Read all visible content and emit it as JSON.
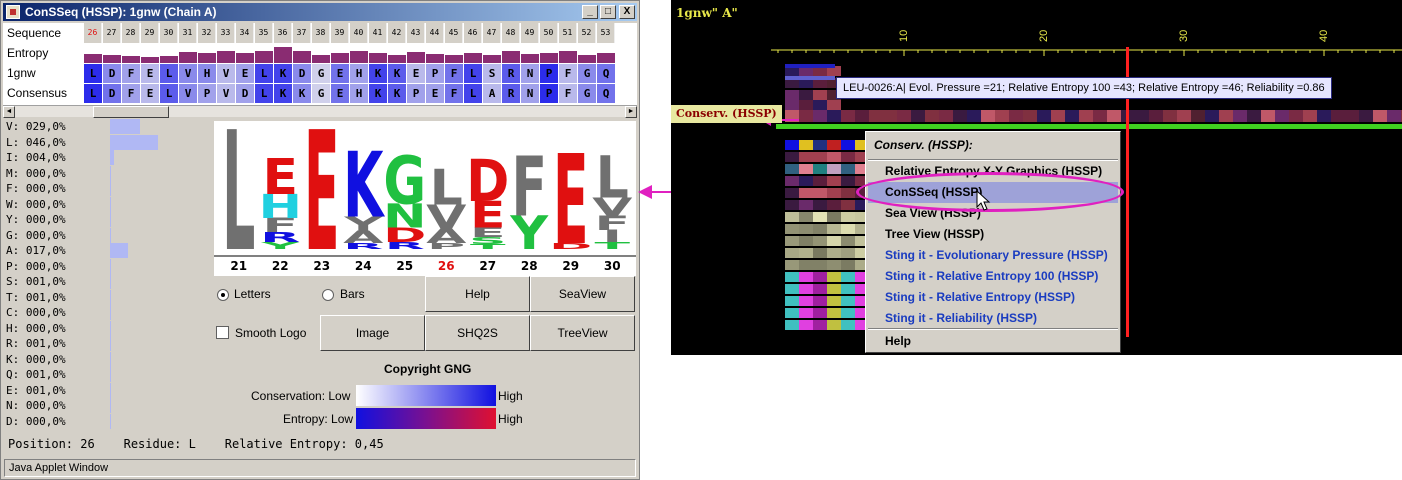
{
  "window": {
    "title": "ConSSeq (HSSP): 1gnw (Chain A)",
    "buttons": [
      "_",
      "□",
      "X"
    ]
  },
  "alignment": {
    "row_labels": [
      "Sequence",
      "Entropy",
      "1gnw",
      "Consensus"
    ],
    "numbers": [
      "26",
      "27",
      "28",
      "29",
      "30",
      "31",
      "32",
      "33",
      "34",
      "35",
      "36",
      "37",
      "38",
      "39",
      "40",
      "41",
      "42",
      "43",
      "44",
      "45",
      "46",
      "47",
      "48",
      "49",
      "50",
      "51",
      "52",
      "53"
    ],
    "current_number": "26",
    "entropy": [
      0.45,
      0.4,
      0.35,
      0.3,
      0.35,
      0.55,
      0.5,
      0.6,
      0.5,
      0.6,
      0.8,
      0.6,
      0.4,
      0.5,
      0.6,
      0.5,
      0.4,
      0.55,
      0.45,
      0.4,
      0.5,
      0.4,
      0.6,
      0.45,
      0.5,
      0.6,
      0.4,
      0.5
    ],
    "seq_1gnw": [
      "L",
      "D",
      "F",
      "E",
      "L",
      "V",
      "H",
      "V",
      "E",
      "L",
      "K",
      "D",
      "G",
      "E",
      "H",
      "K",
      "K",
      "E",
      "P",
      "F",
      "L",
      "S",
      "R",
      "N",
      "P",
      "F",
      "G",
      "Q"
    ],
    "seq_consensus": [
      "L",
      "D",
      "F",
      "E",
      "L",
      "V",
      "P",
      "V",
      "D",
      "L",
      "K",
      "K",
      "G",
      "E",
      "H",
      "K",
      "K",
      "P",
      "E",
      "F",
      "L",
      "A",
      "R",
      "N",
      "P",
      "F",
      "G",
      "Q"
    ],
    "conservation_1gnw": [
      0.9,
      0.5,
      0.4,
      0.3,
      0.7,
      0.5,
      0.5,
      0.3,
      0.4,
      0.8,
      0.8,
      0.5,
      0.2,
      0.6,
      0.4,
      0.8,
      0.7,
      0.3,
      0.4,
      0.6,
      0.8,
      0.3,
      0.7,
      0.4,
      0.9,
      0.3,
      0.5,
      0.6
    ],
    "conservation_consensus": [
      0.9,
      0.6,
      0.4,
      0.3,
      0.7,
      0.5,
      0.4,
      0.3,
      0.4,
      0.8,
      0.8,
      0.5,
      0.2,
      0.6,
      0.4,
      0.8,
      0.7,
      0.4,
      0.4,
      0.6,
      0.8,
      0.3,
      0.7,
      0.4,
      0.9,
      0.3,
      0.5,
      0.6
    ],
    "scroll_left": "◄",
    "scroll_right": "►"
  },
  "frequencies": [
    {
      "text": "V: 029,0%",
      "value": 29.0
    },
    {
      "text": "L: 046,0%",
      "value": 46.0
    },
    {
      "text": "I: 004,0%",
      "value": 4.0
    },
    {
      "text": "M: 000,0%",
      "value": 0.0
    },
    {
      "text": "F: 000,0%",
      "value": 0.0
    },
    {
      "text": "W: 000,0%",
      "value": 0.0
    },
    {
      "text": "Y: 000,0%",
      "value": 0.0
    },
    {
      "text": "G: 000,0%",
      "value": 0.0
    },
    {
      "text": "A: 017,0%",
      "value": 17.0
    },
    {
      "text": "P: 000,0%",
      "value": 0.0
    },
    {
      "text": "S: 001,0%",
      "value": 1.0
    },
    {
      "text": "T: 001,0%",
      "value": 1.0
    },
    {
      "text": "C: 000,0%",
      "value": 0.0
    },
    {
      "text": "H: 000,0%",
      "value": 0.0
    },
    {
      "text": "R: 001,0%",
      "value": 1.0
    },
    {
      "text": "K: 000,0%",
      "value": 0.0
    },
    {
      "text": "Q: 001,0%",
      "value": 1.0
    },
    {
      "text": "E: 001,0%",
      "value": 1.0
    },
    {
      "text": "N: 000,0%",
      "value": 0.0
    },
    {
      "text": "D: 000,0%",
      "value": 0.0
    }
  ],
  "logo": {
    "positions": [
      "21",
      "22",
      "23",
      "24",
      "25",
      "26",
      "27",
      "28",
      "29",
      "30"
    ],
    "current_position": "26",
    "columns": [
      [
        {
          "c": "L",
          "color": "#707070",
          "h": 1.0
        }
      ],
      [
        {
          "c": "E",
          "color": "#e01010",
          "h": 0.3
        },
        {
          "c": "H",
          "color": "#20d0e0",
          "h": 0.2
        },
        {
          "c": "F",
          "color": "#707070",
          "h": 0.12
        },
        {
          "c": "R",
          "color": "#1010e0",
          "h": 0.08
        },
        {
          "c": "Y",
          "color": "#20c040",
          "h": 0.06
        }
      ],
      [
        {
          "c": "E",
          "color": "#e01010",
          "h": 1.0
        }
      ],
      [
        {
          "c": "K",
          "color": "#1010e0",
          "h": 0.55
        },
        {
          "c": "Y",
          "color": "#707070",
          "h": 0.12
        },
        {
          "c": "A",
          "color": "#707070",
          "h": 0.1
        },
        {
          "c": "R",
          "color": "#1010e0",
          "h": 0.05
        }
      ],
      [
        {
          "c": "G",
          "color": "#20c040",
          "h": 0.4
        },
        {
          "c": "N",
          "color": "#20c040",
          "h": 0.2
        },
        {
          "c": "D",
          "color": "#e01010",
          "h": 0.12
        },
        {
          "c": "R",
          "color": "#1010e0",
          "h": 0.06
        }
      ],
      [
        {
          "c": "L",
          "color": "#707070",
          "h": 0.3
        },
        {
          "c": "V",
          "color": "#707070",
          "h": 0.2
        },
        {
          "c": "A",
          "color": "#707070",
          "h": 0.12
        },
        {
          "c": "P",
          "color": "#707070",
          "h": 0.05
        }
      ],
      [
        {
          "c": "D",
          "color": "#e01010",
          "h": 0.35
        },
        {
          "c": "E",
          "color": "#e01010",
          "h": 0.22
        },
        {
          "c": "E",
          "color": "#707070",
          "h": 0.08
        },
        {
          "c": "S",
          "color": "#20c040",
          "h": 0.06
        },
        {
          "c": "T",
          "color": "#20c040",
          "h": 0.04
        }
      ],
      [
        {
          "c": "F",
          "color": "#707070",
          "h": 0.5
        },
        {
          "c": "Y",
          "color": "#20c040",
          "h": 0.28
        }
      ],
      [
        {
          "c": "E",
          "color": "#e01010",
          "h": 0.75
        },
        {
          "c": "D",
          "color": "#e01010",
          "h": 0.05
        }
      ],
      [
        {
          "c": "L",
          "color": "#707070",
          "h": 0.35
        },
        {
          "c": "V",
          "color": "#707070",
          "h": 0.15
        },
        {
          "c": "F",
          "color": "#707070",
          "h": 0.12
        },
        {
          "c": "I",
          "color": "#707070",
          "h": 0.1
        },
        {
          "c": "T",
          "color": "#20c040",
          "h": 0.06
        }
      ]
    ]
  },
  "controls": {
    "letters": "Letters",
    "bars": "Bars",
    "smooth_logo": "Smooth Logo",
    "help": "Help",
    "seaview": "SeaView",
    "image": "Image",
    "shq2s": "SHQ2S",
    "treeview": "TreeView",
    "display_mode": "Letters",
    "smooth_logo_checked": false
  },
  "legend": {
    "copyright": "Copyright GNG",
    "conservation_label": "Conservation: Low",
    "entropy_label": "Entropy: Low",
    "high": "High",
    "conservation_colors": [
      "#ffffff",
      "#1010e0"
    ],
    "entropy_colors": [
      "#1010e0",
      "#e01030"
    ]
  },
  "status": {
    "text": "Position: 26    Residue: L    Relative Entropy: 0,45"
  },
  "applet_bar": "Java Applet Window",
  "viewer": {
    "chain_title": "1gnw\" A\"",
    "ticks": [
      "10",
      "20",
      "30",
      "40"
    ],
    "tooltip": "LEU-0026:A| Evol. Pressure =21; Relative Entropy 100 =43; Relative Entropy =46; Reliability =0.86",
    "track_label": "Conserv. (HSSP)",
    "colors": {
      "background": "#000000",
      "highlight": "#e020c0",
      "green_track": "#40d020",
      "red_line": "#ff2020"
    },
    "menu": {
      "header": "Conserv. (HSSP):",
      "items": [
        "Relative Entropy X-Y Graphics (HSSP)",
        "ConSSeq (HSSP)",
        "Sea View (HSSP)",
        "Tree View (HSSP)",
        "Sting it - Evolutionary Pressure (HSSP)",
        "Sting it - Relative Entropy 100 (HSSP)",
        "Sting it - Relative Entropy (HSSP)",
        "Sting it - Reliability (HSSP)"
      ],
      "selected": "ConSSeq (HSSP)",
      "help": "Help"
    }
  }
}
